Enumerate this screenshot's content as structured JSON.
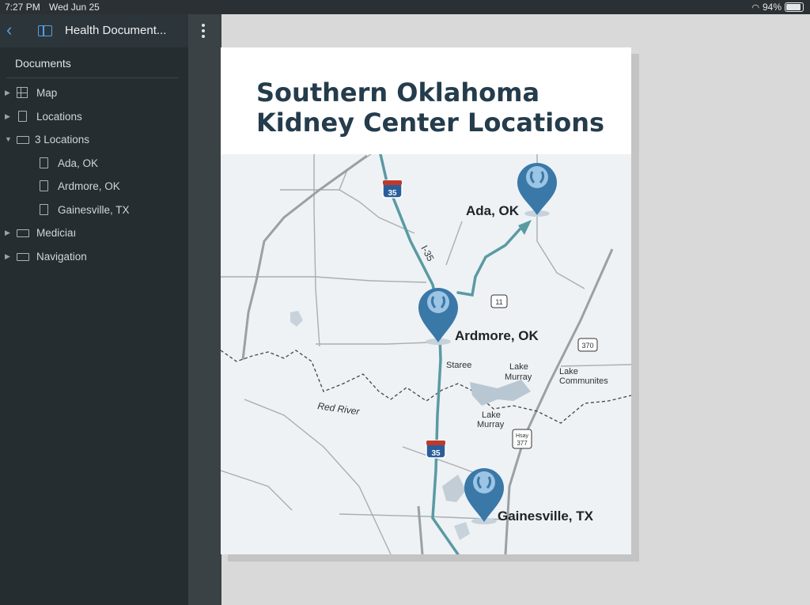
{
  "status_bar": {
    "time": "7:27 PM",
    "date": "Wed Jun 25",
    "battery": "94%"
  },
  "toolbar": {
    "title": "Health Document..."
  },
  "sidebar": {
    "section": "Documents",
    "items": [
      {
        "label": "Map",
        "icon": "grid-icon"
      },
      {
        "label": "Locations",
        "icon": "document-icon"
      },
      {
        "label": "3 Locations",
        "icon": "folder-icon",
        "expanded": true,
        "children": [
          {
            "label": "Ada, OK",
            "icon": "document-icon"
          },
          {
            "label": "Ardmore, OK",
            "icon": "document-icon"
          },
          {
            "label": "Gainesville, TX",
            "icon": "document-icon"
          }
        ]
      },
      {
        "label": "Mediciaı",
        "icon": "folder-icon"
      },
      {
        "label": "Navigation",
        "icon": "folder-icon"
      }
    ]
  },
  "document": {
    "title_line1": "Southern Oklahoma",
    "title_line2": "Kidney Center Locations",
    "map": {
      "locations": [
        "Ada, OK",
        "Ardmore, OK",
        "Gainesville, TX"
      ],
      "shields": {
        "i35_top": "35",
        "i35_bottom": "35",
        "route11": "11",
        "route370": "370",
        "hwy377_line1": "Hsay",
        "hwy377_line2": "377"
      },
      "labels": {
        "i35": "I-35",
        "staree": "Staree",
        "lake_murray_1a": "Lake",
        "lake_murray_1b": "Murray",
        "lake_communities_a": "Lake",
        "lake_communities_b": "Communites",
        "red_river": "Red River",
        "lake_murray_2a": "Lake",
        "lake_murray_2b": "Murray"
      },
      "colors": {
        "route": "#5a9aa3",
        "pin": "#3a78a8",
        "road": "#9aa0a4"
      }
    }
  }
}
